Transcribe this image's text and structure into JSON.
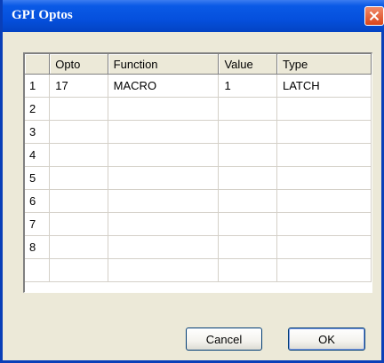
{
  "window": {
    "title": "GPI Optos"
  },
  "grid": {
    "columns": [
      "",
      "Opto",
      "Function",
      "Value",
      "Type"
    ],
    "rows": [
      [
        "1",
        "17",
        "MACRO",
        "1",
        "LATCH"
      ],
      [
        "2",
        "",
        "",
        "",
        ""
      ],
      [
        "3",
        "",
        "",
        "",
        ""
      ],
      [
        "4",
        "",
        "",
        "",
        ""
      ],
      [
        "5",
        "",
        "",
        "",
        ""
      ],
      [
        "6",
        "",
        "",
        "",
        ""
      ],
      [
        "7",
        "",
        "",
        "",
        ""
      ],
      [
        "8",
        "",
        "",
        "",
        ""
      ],
      [
        "",
        "",
        "",
        "",
        ""
      ]
    ]
  },
  "buttons": {
    "cancel_label": "Cancel",
    "ok_label": "OK"
  },
  "icons": {
    "close": "close-icon"
  },
  "colors": {
    "titlebar": "#0550dd",
    "dialog_bg": "#ece9d8",
    "close_button": "#d9451b"
  }
}
